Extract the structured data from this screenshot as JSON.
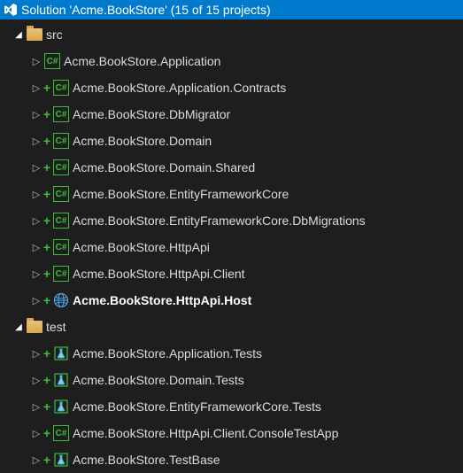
{
  "solution": {
    "label": "Solution 'Acme.BookStore' (15 of 15 projects)"
  },
  "folders": {
    "src": {
      "label": "src"
    },
    "test": {
      "label": "test"
    }
  },
  "projects": {
    "app": "Acme.BookStore.Application",
    "appContracts": "Acme.BookStore.Application.Contracts",
    "dbMigrator": "Acme.BookStore.DbMigrator",
    "domain": "Acme.BookStore.Domain",
    "domainShared": "Acme.BookStore.Domain.Shared",
    "efCore": "Acme.BookStore.EntityFrameworkCore",
    "efCoreMigrations": "Acme.BookStore.EntityFrameworkCore.DbMigrations",
    "httpApi": "Acme.BookStore.HttpApi",
    "httpApiClient": "Acme.BookStore.HttpApi.Client",
    "httpApiHost": "Acme.BookStore.HttpApi.Host",
    "appTests": "Acme.BookStore.Application.Tests",
    "domainTests": "Acme.BookStore.Domain.Tests",
    "efCoreTests": "Acme.BookStore.EntityFrameworkCore.Tests",
    "httpApiClientConsole": "Acme.BookStore.HttpApi.Client.ConsoleTestApp",
    "testBase": "Acme.BookStore.TestBase"
  }
}
